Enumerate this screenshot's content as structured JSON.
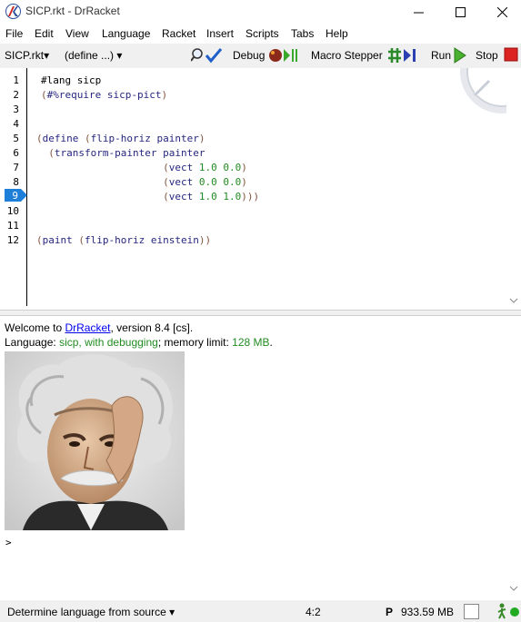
{
  "window": {
    "title": "SICP.rkt - DrRacket"
  },
  "menu": [
    "File",
    "Edit",
    "View",
    "Language",
    "Racket",
    "Insert",
    "Scripts",
    "Tabs",
    "Help"
  ],
  "toolbar": {
    "file_label": "SICP.rkt",
    "define_label": "(define ...)",
    "debug_label": "Debug",
    "macro_stepper_label": "Macro Stepper",
    "run_label": "Run",
    "stop_label": "Stop"
  },
  "editor": {
    "line_numbers": [
      "1",
      "2",
      "3",
      "4",
      "5",
      "6",
      "7",
      "8",
      "9",
      "10",
      "11",
      "12"
    ],
    "breakpoint_line": "9"
  },
  "interactions": {
    "welcome_prefix": "Welcome to ",
    "welcome_link": "DrRacket",
    "welcome_suffix": ", version 8.4 [cs].",
    "lang_prefix": "Language: ",
    "lang_name": "sicp, with debugging",
    "lang_mid": "; memory limit: ",
    "mem_limit": "128 MB",
    "lang_end": ".",
    "prompt": ">"
  },
  "statusbar": {
    "language_selector": "Determine language from source",
    "cursor_position": "4:2",
    "memory_prefix": "P",
    "memory_usage": "933.59 MB"
  },
  "colors": {
    "keyword": "#262680",
    "number": "#228b22",
    "link": "#0000ee",
    "breakpoint": "#1e7fd8",
    "stop": "#dd2222"
  }
}
